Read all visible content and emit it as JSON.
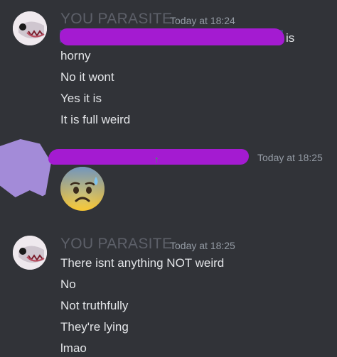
{
  "messages": [
    {
      "author": "YOU PARASITE",
      "timestamp": "Today at 18:24",
      "first_line_suffix": "is",
      "lines": [
        "horny",
        "No it wont",
        "Yes it is",
        "It is full weird"
      ]
    },
    {
      "author_redacted": true,
      "timestamp": "Today at 18:25",
      "reaction_emoji": "anxious-face-with-sweat"
    },
    {
      "author": "YOU PARASITE",
      "timestamp": "Today at 18:25",
      "lines": [
        "There isnt anything NOT weird",
        "No",
        "Not truthfully",
        "They're lying",
        "lmao"
      ]
    }
  ],
  "colors": {
    "background": "#313338",
    "redaction": "#a41bd1",
    "author": "#5d6069",
    "timestamp": "#949ba4",
    "text": "#e3e5e8"
  }
}
